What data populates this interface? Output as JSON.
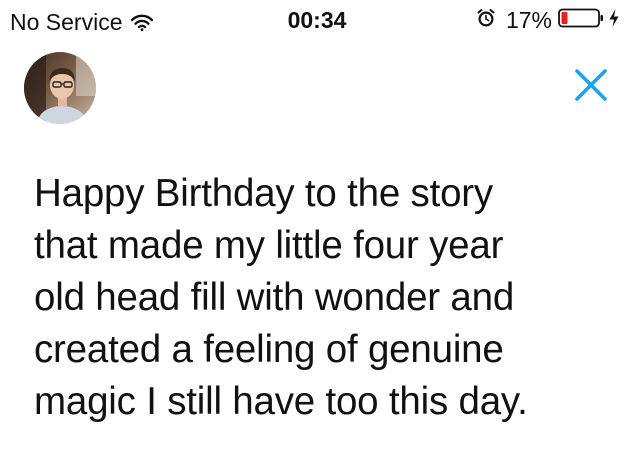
{
  "status_bar": {
    "carrier": "No Service",
    "time": "00:34",
    "battery_percent": "17%",
    "battery_level": 0.17,
    "icons": [
      "wifi-icon",
      "alarm-icon",
      "battery-icon",
      "charging-icon"
    ]
  },
  "header": {
    "avatar_icon": "profile-avatar",
    "close_icon": "close-icon",
    "accent_color": "#1da1f2"
  },
  "tweet": {
    "lines": [
      "Happy Birthday to the story",
      "that made my little four year",
      "old head fill with wonder and",
      "created a feeling of genuine",
      "magic I still have too this day."
    ]
  }
}
